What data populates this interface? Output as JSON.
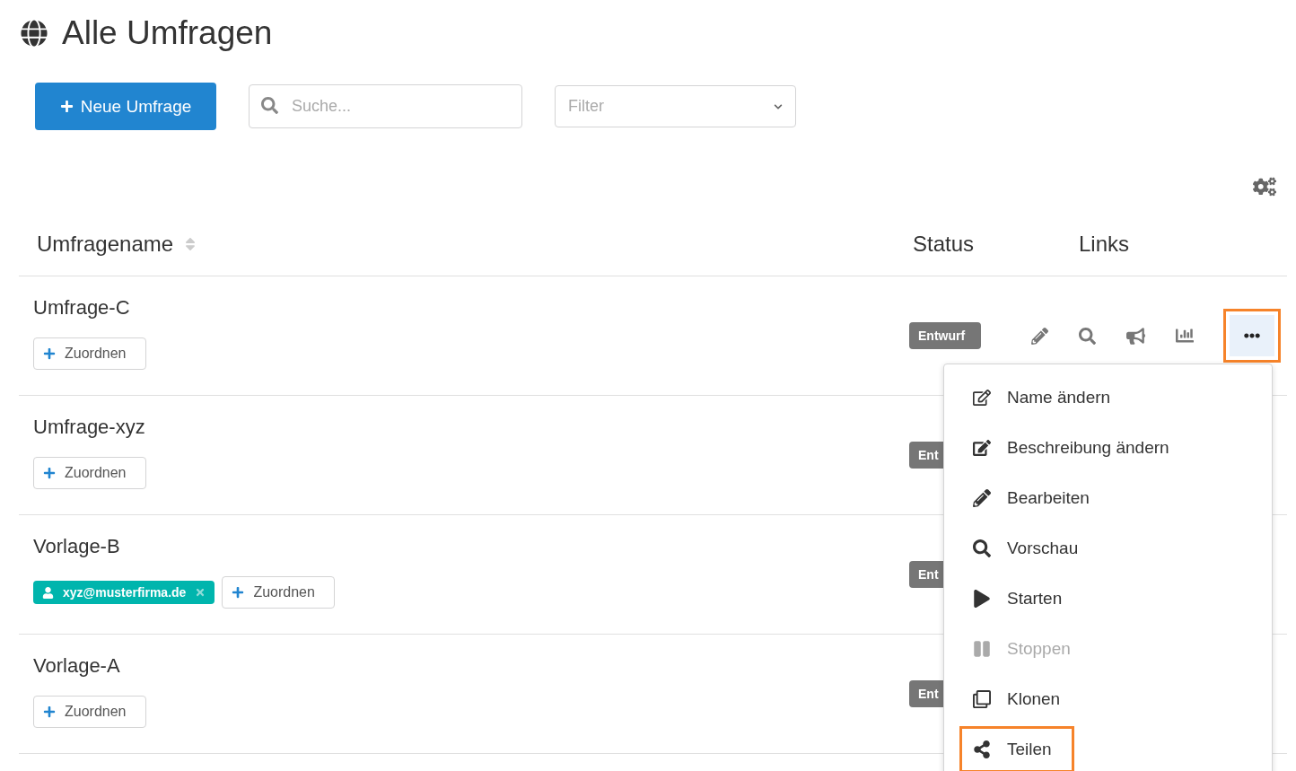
{
  "page": {
    "title": "Alle Umfragen"
  },
  "toolbar": {
    "new_button": "Neue Umfrage",
    "search": {
      "placeholder": "Suche..."
    },
    "filter": {
      "placeholder": "Filter"
    }
  },
  "table": {
    "columns": [
      "Umfragename",
      "Status",
      "Links"
    ],
    "rows": [
      {
        "name": "Umfrage-C",
        "status": "Entwurf",
        "assignees": [],
        "assign_button": "Zuordnen",
        "actions": {
          "more_highlighted": true
        }
      },
      {
        "name": "Umfrage-xyz",
        "status": "Ent",
        "assignees": [],
        "assign_button": "Zuordnen"
      },
      {
        "name": "Vorlage-B",
        "status": "Ent",
        "assignees": [
          "xyz@musterfirma.de"
        ],
        "assign_button": "Zuordnen"
      },
      {
        "name": "Vorlage-A",
        "status": "Ent",
        "assignees": [],
        "assign_button": "Zuordnen"
      }
    ]
  },
  "menu": {
    "items": [
      {
        "kind": "rename",
        "label": "Name ändern",
        "disabled": false,
        "highlighted": false
      },
      {
        "kind": "describe",
        "label": "Beschreibung ändern",
        "disabled": false,
        "highlighted": false
      },
      {
        "kind": "edit",
        "label": "Bearbeiten",
        "disabled": false,
        "highlighted": false
      },
      {
        "kind": "preview",
        "label": "Vorschau",
        "disabled": false,
        "highlighted": false
      },
      {
        "kind": "start",
        "label": "Starten",
        "disabled": false,
        "highlighted": false
      },
      {
        "kind": "stop",
        "label": "Stoppen",
        "disabled": true,
        "highlighted": false
      },
      {
        "kind": "clone",
        "label": "Klonen",
        "disabled": false,
        "highlighted": false
      },
      {
        "kind": "share",
        "label": "Teilen",
        "disabled": false,
        "highlighted": true
      }
    ]
  }
}
